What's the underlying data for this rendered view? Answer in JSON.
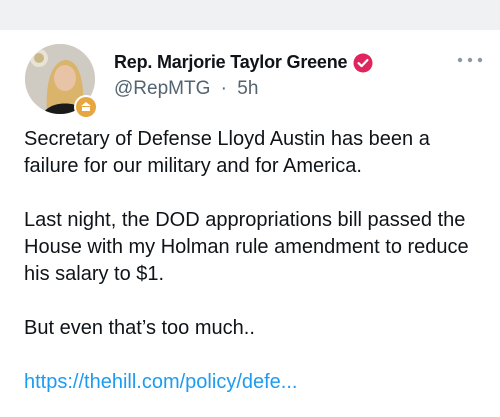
{
  "author": {
    "display_name": "Rep. Marjorie Taylor Greene",
    "handle": "@RepMTG",
    "separator": "·",
    "time_ago": "5h"
  },
  "post": {
    "paragraphs": [
      "Secretary of Defense Lloyd Austin has been a failure for our military and for America.",
      "Last night, the DOD appropriations bill passed the House with my Holman rule amendment to reduce his salary to $1.",
      "But even that’s too much.."
    ],
    "link_text": "https://thehill.com/policy/defe..."
  },
  "icons": {
    "verified": "verified-badge-icon",
    "more": "more-options-icon",
    "affiliation": "government-affiliation-icon"
  },
  "colors": {
    "verified_badge": "#e0245e",
    "link": "#1d9bf0",
    "secondary_text": "#536471",
    "affiliation_badge": "#e8a640"
  }
}
